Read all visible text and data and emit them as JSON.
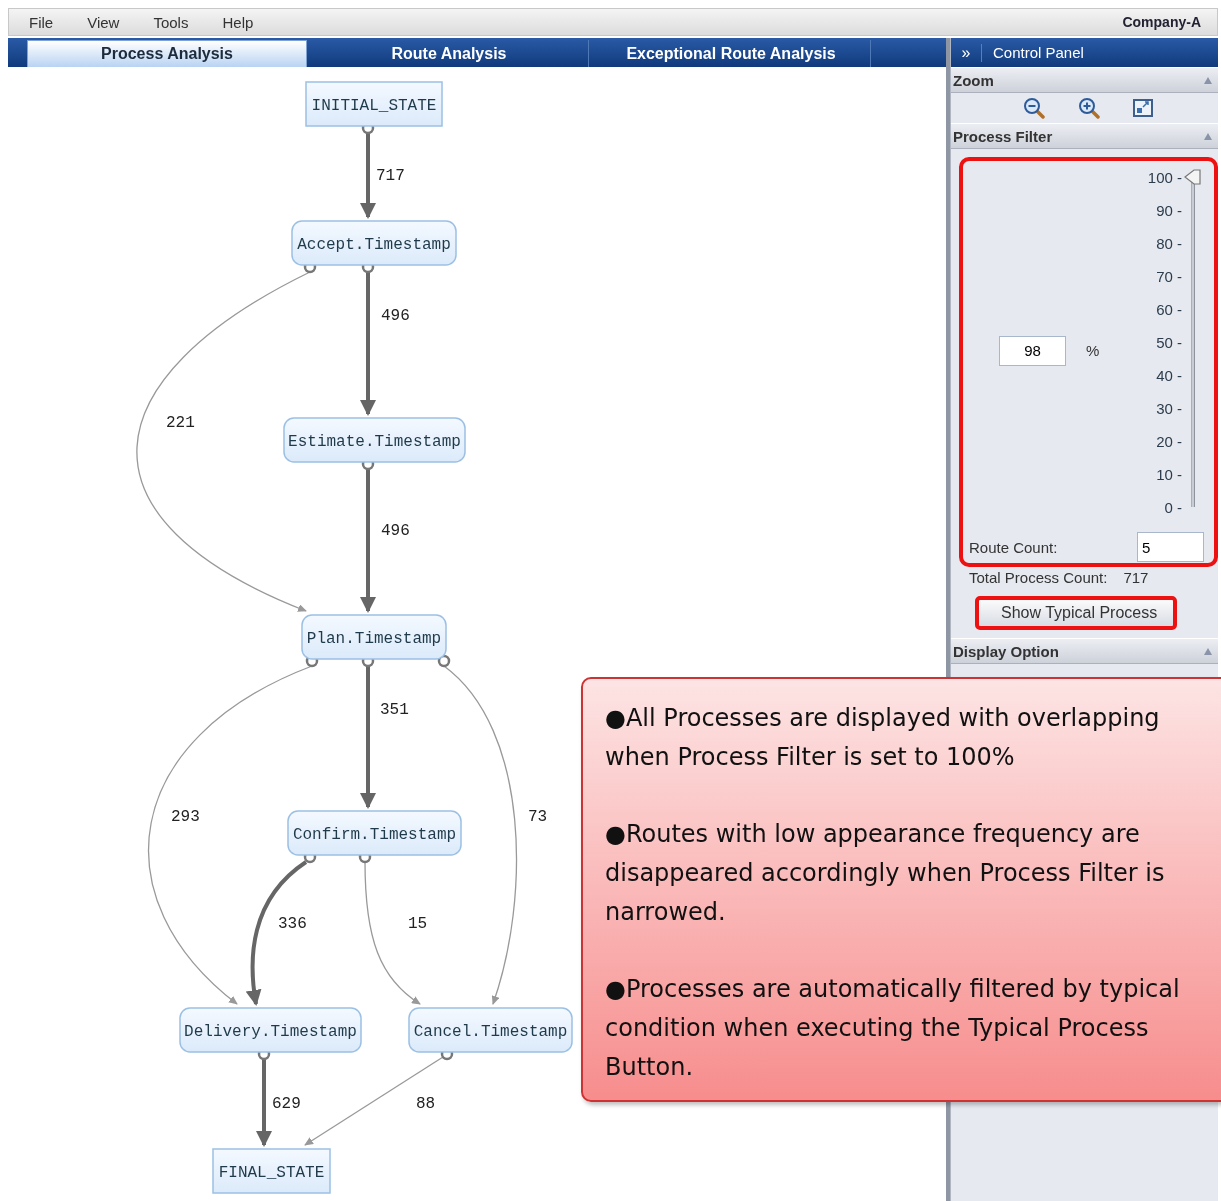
{
  "menu": [
    "File",
    "View",
    "Tools",
    "Help"
  ],
  "company": "Company-A",
  "tabs": [
    {
      "label": "Process Analysis",
      "selected": true
    },
    {
      "label": "Route Analysis",
      "selected": false
    },
    {
      "label": "Exceptional Route Analysis",
      "selected": false
    }
  ],
  "graph": {
    "nodes": [
      {
        "label": "INITIAL_STATE",
        "kind": "state"
      },
      {
        "label": "Accept.Timestamp",
        "kind": "step"
      },
      {
        "label": "Estimate.Timestamp",
        "kind": "step"
      },
      {
        "label": "Plan.Timestamp",
        "kind": "step"
      },
      {
        "label": "Confirm.Timestamp",
        "kind": "step"
      },
      {
        "label": "Delivery.Timestamp",
        "kind": "step"
      },
      {
        "label": "Cancel.Timestamp",
        "kind": "step"
      },
      {
        "label": "FINAL_STATE",
        "kind": "state"
      }
    ],
    "edges": [
      {
        "count": "717",
        "kind": "major"
      },
      {
        "count": "221",
        "kind": "minor"
      },
      {
        "count": "496",
        "kind": "major"
      },
      {
        "count": "496",
        "kind": "major"
      },
      {
        "count": "293",
        "kind": "minor"
      },
      {
        "count": "351",
        "kind": "major"
      },
      {
        "count": "73",
        "kind": "minor"
      },
      {
        "count": "336",
        "kind": "major"
      },
      {
        "count": "15",
        "kind": "minor"
      },
      {
        "count": "629",
        "kind": "major"
      },
      {
        "count": "88",
        "kind": "minor"
      }
    ]
  },
  "control_panel": {
    "toggle": "»",
    "title": "Control Panel",
    "zoom_title": "Zoom",
    "filter_title": "Process Filter",
    "display_title": "Display Option",
    "percent_value": "98",
    "percent_unit": "%",
    "slider": {
      "level": 1,
      "ticks": [
        "100 -",
        "90 -",
        "80 -",
        "70 -",
        "60 -",
        "50 -",
        "40 -",
        "30 -",
        "20 -",
        "10 -",
        "0 -"
      ]
    },
    "route_count_label": "Route Count:",
    "route_count_value": "5",
    "total_label": "Total Process Count:",
    "total_value": "717",
    "button": "Show Typical Process"
  },
  "callout": [
    "●All Processes are displayed with overlapping when Process Filter is set to 100%",
    "●Routes with low appearance frequency are disappeared accordingly when Process Filter is narrowed.",
    "●Processes are automatically filtered by typical condition when executing the Typical Process Button."
  ]
}
